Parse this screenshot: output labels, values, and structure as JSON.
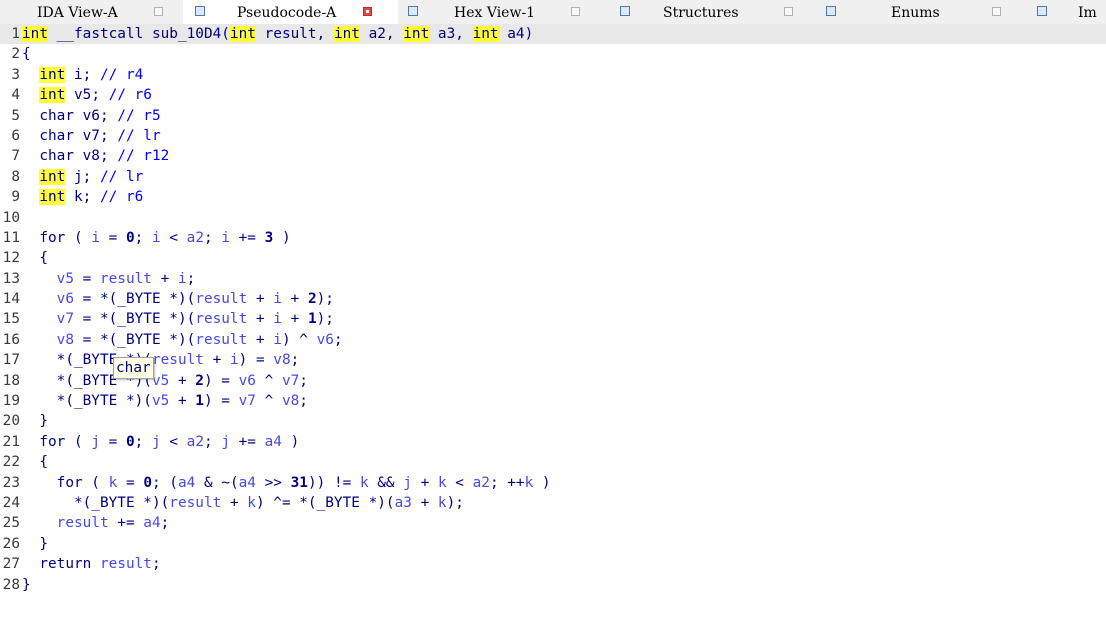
{
  "tabs": [
    {
      "label": "IDA View-A",
      "active": false,
      "close": "tab-close-icon"
    },
    {
      "label": "Pseudocode-A",
      "active": true,
      "close": "tab-close-red-icon"
    },
    {
      "label": "Hex View-1",
      "active": false,
      "close": "tab-close-icon"
    },
    {
      "label": "Structures",
      "active": false,
      "close": "tab-close-icon"
    },
    {
      "label": "Enums",
      "active": false,
      "close": "tab-close-icon"
    },
    {
      "label": "Im",
      "active": false,
      "close": ""
    }
  ],
  "line_numbers": [
    "1",
    "2",
    "3",
    "4",
    "5",
    "6",
    "7",
    "8",
    "9",
    "10",
    "11",
    "12",
    "13",
    "14",
    "15",
    "16",
    "17",
    "18",
    "19",
    "20",
    "21",
    "22",
    "23",
    "24",
    "25",
    "26",
    "27",
    "28"
  ],
  "tooltip": {
    "text": "char"
  },
  "code_lines": [
    [
      {
        "t": "kw",
        "s": "int"
      },
      {
        "t": "k",
        "s": " __fastcall sub_10D4("
      },
      {
        "t": "kw",
        "s": "int"
      },
      {
        "t": "k",
        "s": " result, "
      },
      {
        "t": "kw",
        "s": "int"
      },
      {
        "t": "k",
        "s": " a2, "
      },
      {
        "t": "kw",
        "s": "int"
      },
      {
        "t": "k",
        "s": " a3, "
      },
      {
        "t": "kw",
        "s": "int"
      },
      {
        "t": "k",
        "s": " a4)"
      }
    ],
    [
      {
        "t": "k",
        "s": "{"
      }
    ],
    [
      {
        "t": "k",
        "s": "  "
      },
      {
        "t": "kw",
        "s": "int"
      },
      {
        "t": "k",
        "s": " i; "
      },
      {
        "t": "c",
        "s": "// r4"
      }
    ],
    [
      {
        "t": "k",
        "s": "  "
      },
      {
        "t": "kw",
        "s": "int"
      },
      {
        "t": "k",
        "s": " v5; "
      },
      {
        "t": "c",
        "s": "// r6"
      }
    ],
    [
      {
        "t": "k",
        "s": "  char v6; "
      },
      {
        "t": "c",
        "s": "// r5"
      }
    ],
    [
      {
        "t": "k",
        "s": "  char v7; "
      },
      {
        "t": "c",
        "s": "// lr"
      }
    ],
    [
      {
        "t": "k",
        "s": "  char v8; "
      },
      {
        "t": "c",
        "s": "// r12"
      }
    ],
    [
      {
        "t": "k",
        "s": "  "
      },
      {
        "t": "kw",
        "s": "int"
      },
      {
        "t": "k",
        "s": " j; "
      },
      {
        "t": "c",
        "s": "// lr"
      }
    ],
    [
      {
        "t": "k",
        "s": "  "
      },
      {
        "t": "kw",
        "s": "int"
      },
      {
        "t": "k",
        "s": " k; "
      },
      {
        "t": "c",
        "s": "// r6"
      }
    ],
    [],
    [
      {
        "t": "k",
        "s": "  for ( "
      },
      {
        "t": "v",
        "s": "i"
      },
      {
        "t": "k",
        "s": " = "
      },
      {
        "t": "n",
        "s": "0"
      },
      {
        "t": "k",
        "s": "; "
      },
      {
        "t": "v",
        "s": "i"
      },
      {
        "t": "k",
        "s": " < "
      },
      {
        "t": "v",
        "s": "a2"
      },
      {
        "t": "k",
        "s": "; "
      },
      {
        "t": "v",
        "s": "i"
      },
      {
        "t": "k",
        "s": " += "
      },
      {
        "t": "n",
        "s": "3"
      },
      {
        "t": "k",
        "s": " )"
      }
    ],
    [
      {
        "t": "k",
        "s": "  {"
      }
    ],
    [
      {
        "t": "k",
        "s": "    "
      },
      {
        "t": "v",
        "s": "v5"
      },
      {
        "t": "k",
        "s": " = "
      },
      {
        "t": "v",
        "s": "result"
      },
      {
        "t": "k",
        "s": " + "
      },
      {
        "t": "v",
        "s": "i"
      },
      {
        "t": "k",
        "s": ";"
      }
    ],
    [
      {
        "t": "k",
        "s": "    "
      },
      {
        "t": "v",
        "s": "v6"
      },
      {
        "t": "k",
        "s": " = *(_BYTE *)("
      },
      {
        "t": "v",
        "s": "result"
      },
      {
        "t": "k",
        "s": " + "
      },
      {
        "t": "v",
        "s": "i"
      },
      {
        "t": "k",
        "s": " + "
      },
      {
        "t": "n",
        "s": "2"
      },
      {
        "t": "k",
        "s": ");"
      }
    ],
    [
      {
        "t": "k",
        "s": "    "
      },
      {
        "t": "v",
        "s": "v7"
      },
      {
        "t": "k",
        "s": " = *(_BYTE *)("
      },
      {
        "t": "v",
        "s": "result"
      },
      {
        "t": "k",
        "s": " + "
      },
      {
        "t": "v",
        "s": "i"
      },
      {
        "t": "k",
        "s": " + "
      },
      {
        "t": "n",
        "s": "1"
      },
      {
        "t": "k",
        "s": ");"
      }
    ],
    [
      {
        "t": "k",
        "s": "    "
      },
      {
        "t": "v",
        "s": "v8"
      },
      {
        "t": "k",
        "s": " = *(_BYTE *)("
      },
      {
        "t": "v",
        "s": "result"
      },
      {
        "t": "k",
        "s": " + "
      },
      {
        "t": "v",
        "s": "i"
      },
      {
        "t": "k",
        "s": ") ^ "
      },
      {
        "t": "v",
        "s": "v6"
      },
      {
        "t": "k",
        "s": ";"
      }
    ],
    [
      {
        "t": "k",
        "s": "    *(_BYTE *)("
      },
      {
        "t": "v",
        "s": "result"
      },
      {
        "t": "k",
        "s": " + "
      },
      {
        "t": "v",
        "s": "i"
      },
      {
        "t": "k",
        "s": ") = "
      },
      {
        "t": "v",
        "s": "v8"
      },
      {
        "t": "k",
        "s": ";"
      }
    ],
    [
      {
        "t": "k",
        "s": "    *(_BYTE *)("
      },
      {
        "t": "v",
        "s": "v5"
      },
      {
        "t": "k",
        "s": " + "
      },
      {
        "t": "n",
        "s": "2"
      },
      {
        "t": "k",
        "s": ") = "
      },
      {
        "t": "v",
        "s": "v6"
      },
      {
        "t": "k",
        "s": " ^ "
      },
      {
        "t": "v",
        "s": "v7"
      },
      {
        "t": "k",
        "s": ";"
      }
    ],
    [
      {
        "t": "k",
        "s": "    *(_BYTE *)("
      },
      {
        "t": "v",
        "s": "v5"
      },
      {
        "t": "k",
        "s": " + "
      },
      {
        "t": "n",
        "s": "1"
      },
      {
        "t": "k",
        "s": ") = "
      },
      {
        "t": "v",
        "s": "v7"
      },
      {
        "t": "k",
        "s": " ^ "
      },
      {
        "t": "v",
        "s": "v8"
      },
      {
        "t": "k",
        "s": ";"
      }
    ],
    [
      {
        "t": "k",
        "s": "  }"
      }
    ],
    [
      {
        "t": "k",
        "s": "  for ( "
      },
      {
        "t": "v",
        "s": "j"
      },
      {
        "t": "k",
        "s": " = "
      },
      {
        "t": "n",
        "s": "0"
      },
      {
        "t": "k",
        "s": "; "
      },
      {
        "t": "v",
        "s": "j"
      },
      {
        "t": "k",
        "s": " < "
      },
      {
        "t": "v",
        "s": "a2"
      },
      {
        "t": "k",
        "s": "; "
      },
      {
        "t": "v",
        "s": "j"
      },
      {
        "t": "k",
        "s": " += "
      },
      {
        "t": "v",
        "s": "a4"
      },
      {
        "t": "k",
        "s": " )"
      }
    ],
    [
      {
        "t": "k",
        "s": "  {"
      }
    ],
    [
      {
        "t": "k",
        "s": "    for ( "
      },
      {
        "t": "v",
        "s": "k"
      },
      {
        "t": "k",
        "s": " = "
      },
      {
        "t": "n",
        "s": "0"
      },
      {
        "t": "k",
        "s": "; ("
      },
      {
        "t": "v",
        "s": "a4"
      },
      {
        "t": "k",
        "s": " & ~("
      },
      {
        "t": "v",
        "s": "a4"
      },
      {
        "t": "k",
        "s": " >> "
      },
      {
        "t": "n",
        "s": "31"
      },
      {
        "t": "k",
        "s": ")) != "
      },
      {
        "t": "v",
        "s": "k"
      },
      {
        "t": "k",
        "s": " && "
      },
      {
        "t": "v",
        "s": "j"
      },
      {
        "t": "k",
        "s": " + "
      },
      {
        "t": "v",
        "s": "k"
      },
      {
        "t": "k",
        "s": " < "
      },
      {
        "t": "v",
        "s": "a2"
      },
      {
        "t": "k",
        "s": "; ++"
      },
      {
        "t": "v",
        "s": "k"
      },
      {
        "t": "k",
        "s": " )"
      }
    ],
    [
      {
        "t": "k",
        "s": "      *(_BYTE *)("
      },
      {
        "t": "v",
        "s": "result"
      },
      {
        "t": "k",
        "s": " + "
      },
      {
        "t": "v",
        "s": "k"
      },
      {
        "t": "k",
        "s": ") ^= *(_BYTE *)("
      },
      {
        "t": "v",
        "s": "a3"
      },
      {
        "t": "k",
        "s": " + "
      },
      {
        "t": "v",
        "s": "k"
      },
      {
        "t": "k",
        "s": ");"
      }
    ],
    [
      {
        "t": "k",
        "s": "    "
      },
      {
        "t": "v",
        "s": "result"
      },
      {
        "t": "k",
        "s": " += "
      },
      {
        "t": "v",
        "s": "a4"
      },
      {
        "t": "k",
        "s": ";"
      }
    ],
    [
      {
        "t": "k",
        "s": "  }"
      }
    ],
    [
      {
        "t": "k",
        "s": "  return "
      },
      {
        "t": "v",
        "s": "result"
      },
      {
        "t": "k",
        "s": ";"
      }
    ],
    [
      {
        "t": "k",
        "s": "}"
      }
    ]
  ]
}
